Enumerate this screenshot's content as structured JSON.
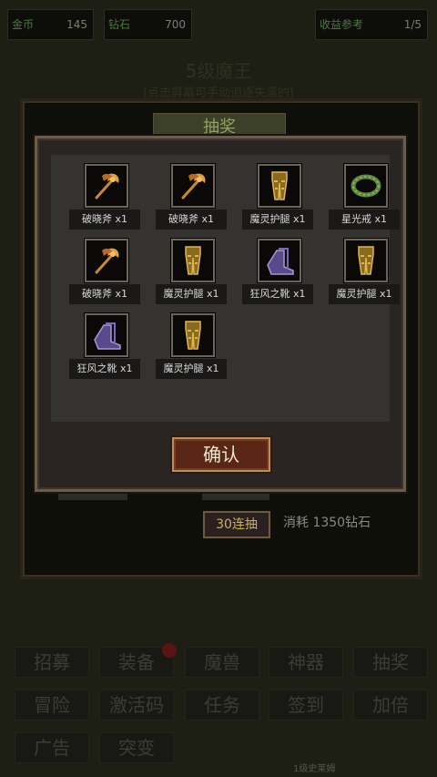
{
  "top_bar": {
    "gold_label": "金币",
    "gold_value": "145",
    "diamond_label": "钻石",
    "diamond_value": "700",
    "rate_label": "收益参考",
    "rate_value": "1/5"
  },
  "boss": {
    "title": "5级魔王",
    "subtitle": "(点击屏幕可手动追逐失落的)"
  },
  "background": {
    "tab_label": "抽奖",
    "draw30_label": "30连抽",
    "cost_label": "消耗 1350钻石"
  },
  "reward_modal": {
    "items": [
      {
        "name": "破晓斧 x1",
        "icon": "axe-icon"
      },
      {
        "name": "破晓斧 x1",
        "icon": "axe-icon"
      },
      {
        "name": "魔灵护腿 x1",
        "icon": "leggings-icon"
      },
      {
        "name": "星光戒 x1",
        "icon": "ring-icon"
      },
      {
        "name": "破晓斧 x1",
        "icon": "axe-icon"
      },
      {
        "name": "魔灵护腿 x1",
        "icon": "leggings-icon"
      },
      {
        "name": "狂风之靴 x1",
        "icon": "boots-icon"
      },
      {
        "name": "魔灵护腿 x1",
        "icon": "leggings-icon"
      },
      {
        "name": "狂风之靴 x1",
        "icon": "boots-icon"
      },
      {
        "name": "魔灵护腿 x1",
        "icon": "leggings-icon"
      }
    ],
    "confirm_label": "确认"
  },
  "menu": {
    "row1": [
      "招募",
      "装备",
      "魔兽",
      "神器",
      "抽奖"
    ],
    "row2": [
      "冒险",
      "激活码",
      "任务",
      "签到",
      "加倍"
    ],
    "row3": [
      "广告",
      "突变"
    ]
  },
  "footer": {
    "text": "1级史莱姆"
  },
  "colors": {
    "confirm_bg": "#5a2616",
    "draw_label": "#c8b455"
  }
}
